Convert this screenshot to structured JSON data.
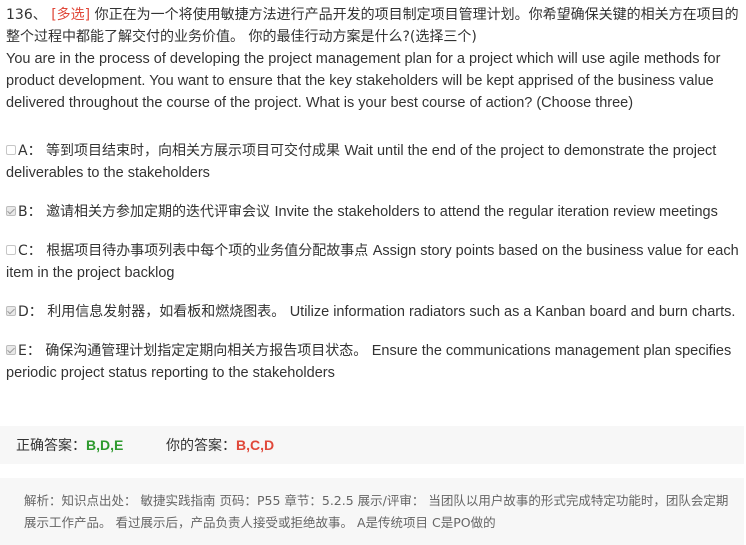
{
  "question": {
    "number": "136、",
    "type_tag": "[多选]",
    "zh_text": "你正在为一个将使用敏捷方法进行产品开发的项目制定项目管理计划。你希望确保关键的相关方在项目的整个过程中都能了解交付的业务价值。 你的最佳行动方案是什么?(选择三个)",
    "en_text": "You are in the process of developing the project management plan for a project which will use agile methods for product development. You want to ensure that the key stakeholders will be kept apprised of the business value delivered throughout the course of the project. What is your best course of action? (Choose three)"
  },
  "options": [
    {
      "letter": "A：",
      "zh": "等到项目结束时，向相关方展示项目可交付成果",
      "en": "Wait until the end of the project to demonstrate the project deliverables to the stakeholders",
      "checked": false
    },
    {
      "letter": "B：",
      "zh": "邀请相关方参加定期的迭代评审会议",
      "en": "Invite the stakeholders to attend the regular iteration review meetings",
      "checked": true
    },
    {
      "letter": "C：",
      "zh": "根据项目待办事项列表中每个项的业务值分配故事点",
      "en": "Assign story points based on the business value for each item in the project backlog",
      "checked": false
    },
    {
      "letter": "D：",
      "zh": "利用信息发射器，如看板和燃烧图表。",
      "en": "Utilize information radiators such as a Kanban board and burn charts.",
      "checked": true
    },
    {
      "letter": "E：",
      "zh": "确保沟通管理计划指定定期向相关方报告项目状态。",
      "en": "Ensure the communications management plan specifies periodic project status reporting to the stakeholders",
      "checked": true
    }
  ],
  "answer": {
    "correct_label": "正确答案：",
    "correct_value": "B,D,E",
    "yours_label": "你的答案：",
    "yours_value": "B,C,D"
  },
  "explanation": {
    "text": "解析：知识点出处：  敏捷实践指南 页码：P55 章节：5.2.5 展示/评审：  当团队以用户故事的形式完成特定功能时，团队会定期展示工作产品。  看过展示后，产品负责人接受或拒绝故事。  A是传统项目 C是PO做的"
  },
  "colors": {
    "accent_red": "#e0483a",
    "correct_green": "#2e9a2e",
    "panel_bg": "#f7f7f7"
  }
}
